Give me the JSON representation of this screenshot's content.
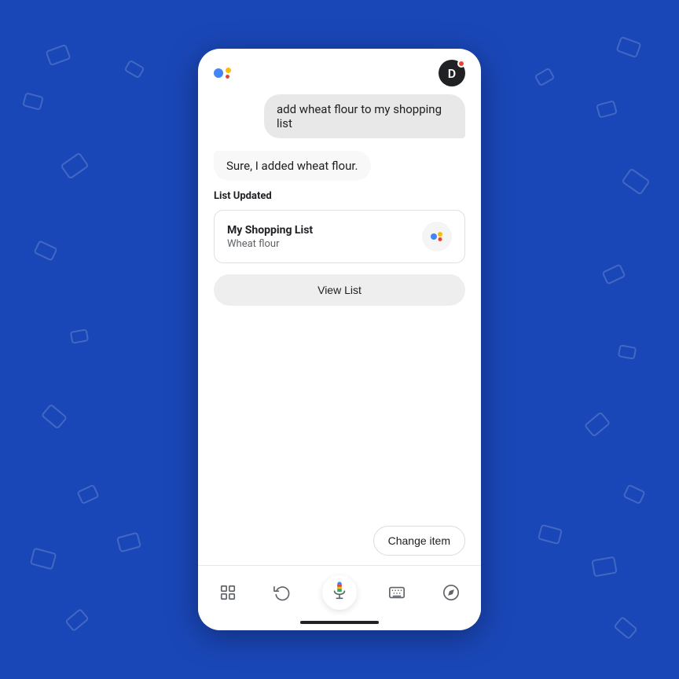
{
  "background": {
    "color": "#1a47b8"
  },
  "topBar": {
    "assistantIconAlt": "Google Assistant icon",
    "userAvatarLabel": "D",
    "userAvatarAlt": "User avatar"
  },
  "conversation": {
    "userMessage": "add wheat flour to my shopping list",
    "assistantResponse": "Sure, I added wheat flour.",
    "listUpdatedLabel": "List Updated"
  },
  "shoppingCard": {
    "listTitle": "My Shopping List",
    "listItem": "Wheat flour"
  },
  "buttons": {
    "viewList": "View List",
    "changeItem": "Change item"
  },
  "bottomToolbar": {
    "icons": [
      {
        "name": "routines-icon",
        "label": "Routines"
      },
      {
        "name": "history-icon",
        "label": "History"
      },
      {
        "name": "microphone-icon",
        "label": "Microphone"
      },
      {
        "name": "keyboard-icon",
        "label": "Keyboard"
      },
      {
        "name": "explore-icon",
        "label": "Explore"
      }
    ]
  }
}
